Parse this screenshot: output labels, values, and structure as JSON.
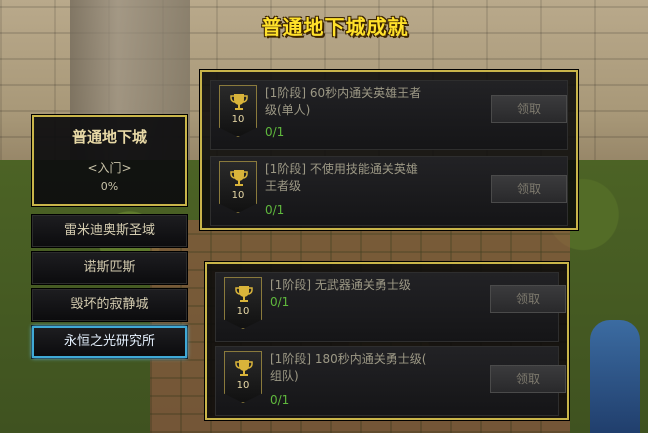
{
  "page_title": "普通地下城成就",
  "category": {
    "title": "普通地下城",
    "stage": "<入门>",
    "progress": "0%"
  },
  "dungeons": [
    {
      "label": "雷米迪奥斯圣域",
      "selected": false
    },
    {
      "label": "诺斯匹斯",
      "selected": false
    },
    {
      "label": "毁坏的寂静城",
      "selected": false
    },
    {
      "label": "永恒之光研究所",
      "selected": true
    }
  ],
  "achievements": [
    {
      "points": "10",
      "text_line1": "[1阶段] 60秒内通关英雄王者",
      "text_line2": "级(单人)",
      "progress": "0/1",
      "button": "领取"
    },
    {
      "points": "10",
      "text_line1": "[1阶段] 不使用技能通关英雄",
      "text_line2": "王者级",
      "progress": "0/1",
      "button": "领取"
    },
    {
      "points": "10",
      "text_line1": "[1阶段] 无武器通关勇士级",
      "text_line2": "",
      "progress": "0/1",
      "button": "领取"
    },
    {
      "points": "10",
      "text_line1": "[1阶段] 180秒内通关勇士级(",
      "text_line2": "组队)",
      "progress": "0/1",
      "button": "领取"
    }
  ],
  "colors": {
    "panel_border": "#c9b54a",
    "title_yellow": "#ffe12a",
    "progress_green": "#5fb83d",
    "selected_border": "#3fa9d6"
  }
}
